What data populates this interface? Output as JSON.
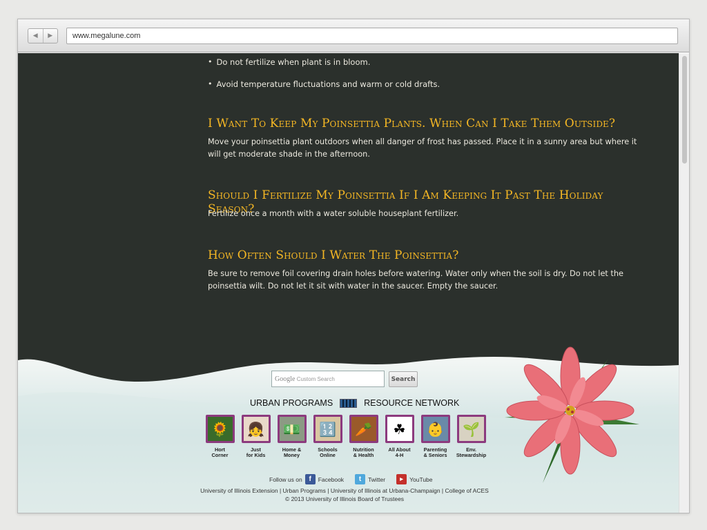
{
  "browser": {
    "url": "www.megalune.com",
    "back_icon": "back-arrow-icon",
    "forward_icon": "forward-arrow-icon"
  },
  "bullets": [
    "Do not fertilize when plant is in bloom.",
    "Avoid temperature fluctuations and warm or cold drafts."
  ],
  "faq": [
    {
      "question": "I Want To Keep My Poinsettia Plants. When Can I Take Them Outside?",
      "answer": "Move your poinsettia plant outdoors when all danger of frost has passed. Place it in a sunny area but where it will get moderate shade in the afternoon."
    },
    {
      "question": "Should I Fertilize My Poinsettia If I Am Keeping It Past The Holiday Season?",
      "answer": "Fertilize once a month with a water soluble houseplant fertilizer."
    },
    {
      "question": "How Often Should I Water The Poinsettia?",
      "answer": "Be sure to remove foil covering drain holes before watering. Water only when the soil is dry. Do not let the poinsettia wilt. Do not let it sit with water in the saucer. Empty the saucer."
    }
  ],
  "search": {
    "brand": "Google",
    "placeholder": "Custom Search",
    "button_label": "Search"
  },
  "urban": {
    "left": "URBAN PROGRAMS",
    "right": "RESOURCE NETWORK"
  },
  "tiles": [
    {
      "label": "Hort\nCorner",
      "icon": "sunflower-icon",
      "glyph": "🌻",
      "bg": "#3a6b2a"
    },
    {
      "label": "Just\nfor Kids",
      "icon": "kids-icon",
      "glyph": "👧",
      "bg": "#e9d9c9"
    },
    {
      "label": "Home &\nMoney",
      "icon": "money-icon",
      "glyph": "💵",
      "bg": "#8c9a84"
    },
    {
      "label": "Schools\nOnline",
      "icon": "blocks-icon",
      "glyph": "🔢",
      "bg": "#d9c6a2"
    },
    {
      "label": "Nutrition\n& Health",
      "icon": "vegetables-icon",
      "glyph": "🥕",
      "bg": "#9a5a2a"
    },
    {
      "label": "All About\n4-H",
      "icon": "clover-icon",
      "glyph": "☘",
      "bg": "#ffffff"
    },
    {
      "label": "Parenting\n& Seniors",
      "icon": "family-icon",
      "glyph": "👶",
      "bg": "#6a8aa8"
    },
    {
      "label": "Env.\nStewardship",
      "icon": "seedling-icon",
      "glyph": "🌱",
      "bg": "#d8d2c2"
    }
  ],
  "social": {
    "prefix": "Follow us on",
    "facebook": "Facebook",
    "twitter": "Twitter",
    "youtube": "YouTube"
  },
  "footer": {
    "links": "University of Illinois Extension | Urban Programs | University of Illinois at Urbana-Champaign | College of ACES",
    "copyright": "© 2013 University of Illinois Board of Trustees"
  },
  "colors": {
    "page_bg": "#2b302c",
    "heading": "#f5b724",
    "body_text": "#ece9df",
    "tile_border": "#8c3a7e"
  }
}
